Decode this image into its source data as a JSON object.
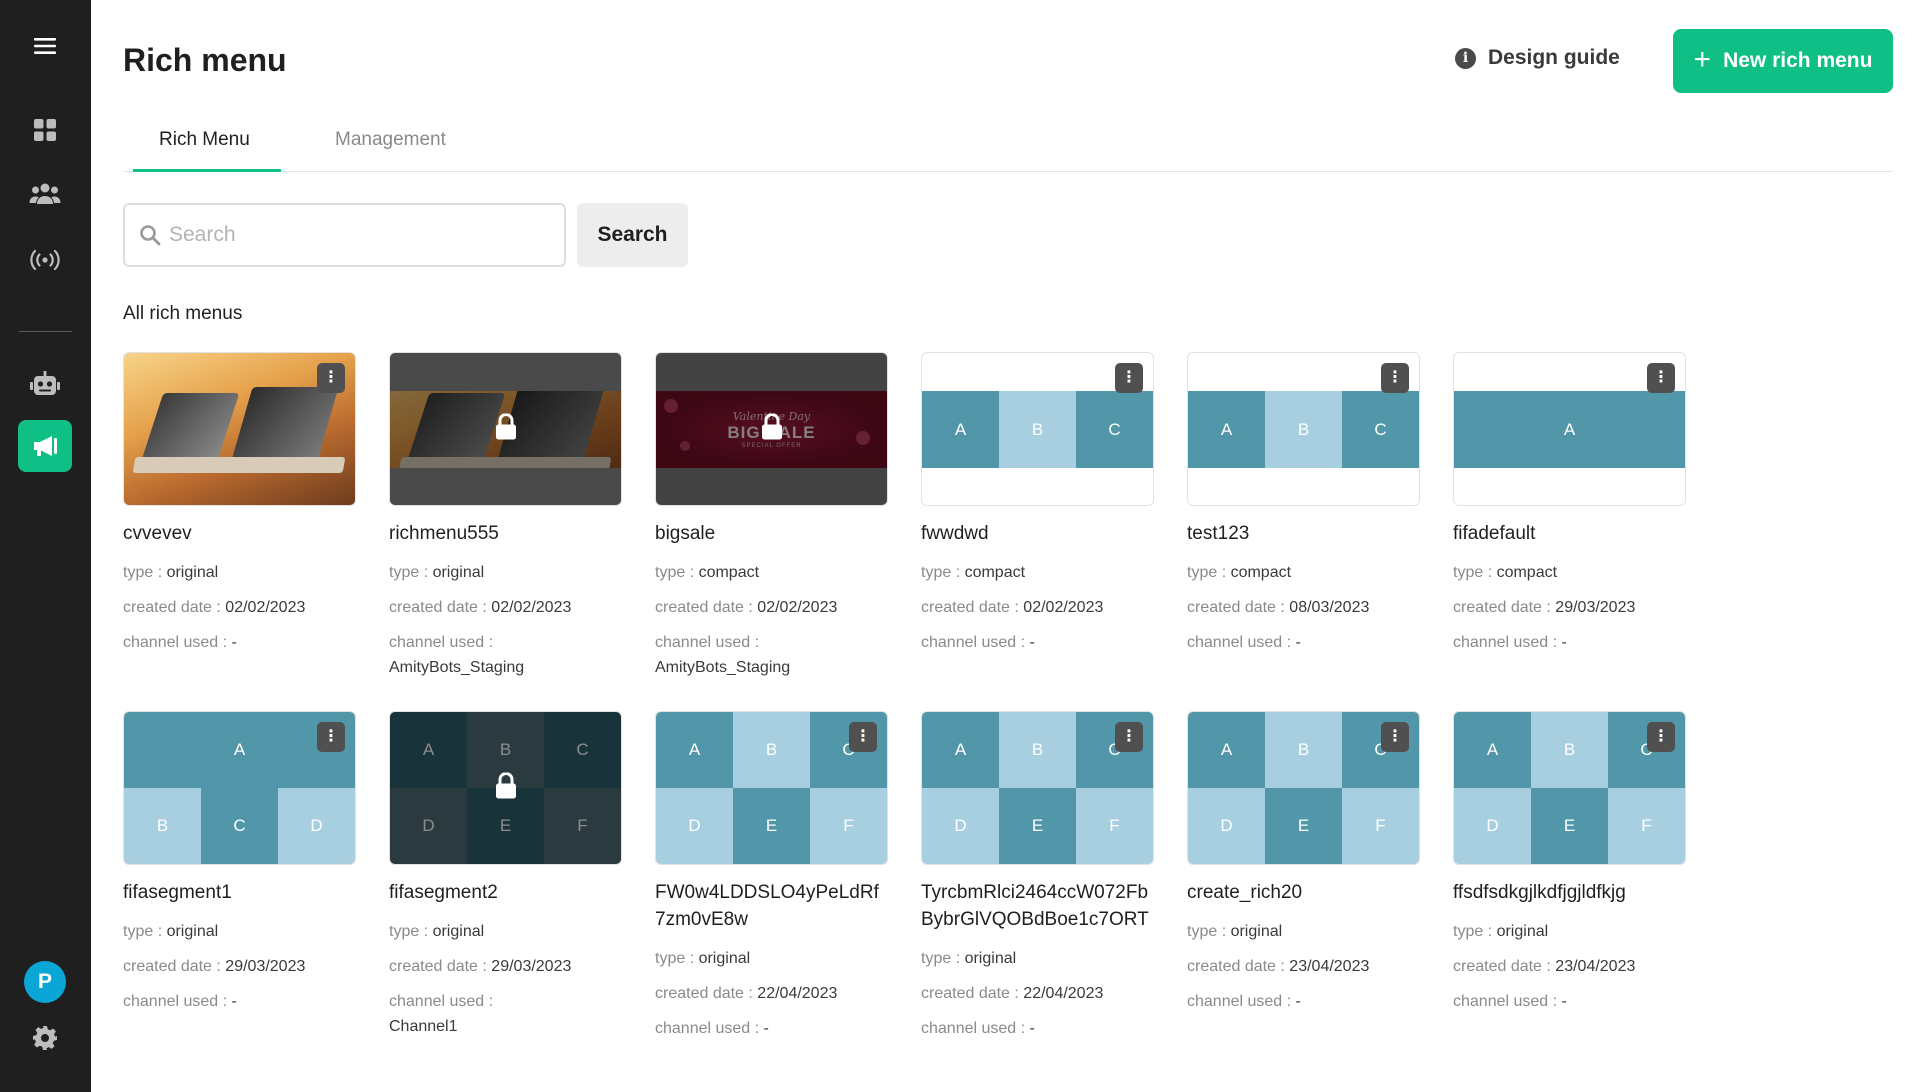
{
  "header": {
    "title": "Rich menu",
    "design_guide": "Design guide",
    "new_button": "New rich menu"
  },
  "tabs": [
    {
      "label": "Rich Menu",
      "active": true
    },
    {
      "label": "Management",
      "active": false
    }
  ],
  "search": {
    "placeholder": "Search",
    "button": "Search"
  },
  "section_title": "All rich menus",
  "labels": {
    "type": "type : ",
    "created": "created date : ",
    "channel": "channel used : "
  },
  "sidebar": {
    "avatar_letter": "P"
  },
  "colors": {
    "accent": "#10bf85",
    "sidebar_bg": "#1f1f1f",
    "tile_dark": "#5196a9",
    "tile_light": "#a8cfe0"
  },
  "cards": [
    {
      "name": "cvvevev",
      "type": "original",
      "created": "02/02/2023",
      "channel": "-"
    },
    {
      "name": "richmenu555",
      "type": "original",
      "created": "02/02/2023",
      "channel": "AmityBots_Staging"
    },
    {
      "name": "bigsale",
      "type": "compact",
      "created": "02/02/2023",
      "channel": "AmityBots_Staging",
      "sale_script": "Valentine Day",
      "sale_big": "BIG SALE",
      "sale_small": "SPECIAL OFFER"
    },
    {
      "name": "fwwdwd",
      "type": "compact",
      "created": "02/02/2023",
      "channel": "-",
      "cells": [
        "A",
        "B",
        "C"
      ]
    },
    {
      "name": "test123",
      "type": "compact",
      "created": "08/03/2023",
      "channel": "-",
      "cells": [
        "A",
        "B",
        "C"
      ]
    },
    {
      "name": "fifadefault",
      "type": "compact",
      "created": "29/03/2023",
      "channel": "-",
      "cells": [
        "A"
      ]
    },
    {
      "name": "fifasegment1",
      "type": "original",
      "created": "29/03/2023",
      "channel": "-",
      "cells": [
        "A",
        "B",
        "C",
        "D"
      ]
    },
    {
      "name": "fifasegment2",
      "type": "original",
      "created": "29/03/2023",
      "channel": "Channel1",
      "cells": [
        "A",
        "B",
        "C",
        "D",
        "E",
        "F"
      ]
    },
    {
      "name": "FW0w4LDDSLO4yPeLdRf7zm0vE8w",
      "type": "original",
      "created": "22/04/2023",
      "channel": "-",
      "cells": [
        "A",
        "B",
        "C",
        "D",
        "E",
        "F"
      ]
    },
    {
      "name": "TyrcbmRlci2464ccW072FbBybrGlVQOBdBoe1c7ORT",
      "type": "original",
      "created": "22/04/2023",
      "channel": "-",
      "cells": [
        "A",
        "B",
        "C",
        "D",
        "E",
        "F"
      ]
    },
    {
      "name": "create_rich20",
      "type": "original",
      "created": "23/04/2023",
      "channel": "-",
      "cells": [
        "A",
        "B",
        "C",
        "D",
        "E",
        "F"
      ]
    },
    {
      "name": "ffsdfsdkgjlkdfjgjldfkjg",
      "type": "original",
      "created": "23/04/2023",
      "channel": "-",
      "cells": [
        "A",
        "B",
        "C",
        "D",
        "E",
        "F"
      ]
    }
  ]
}
